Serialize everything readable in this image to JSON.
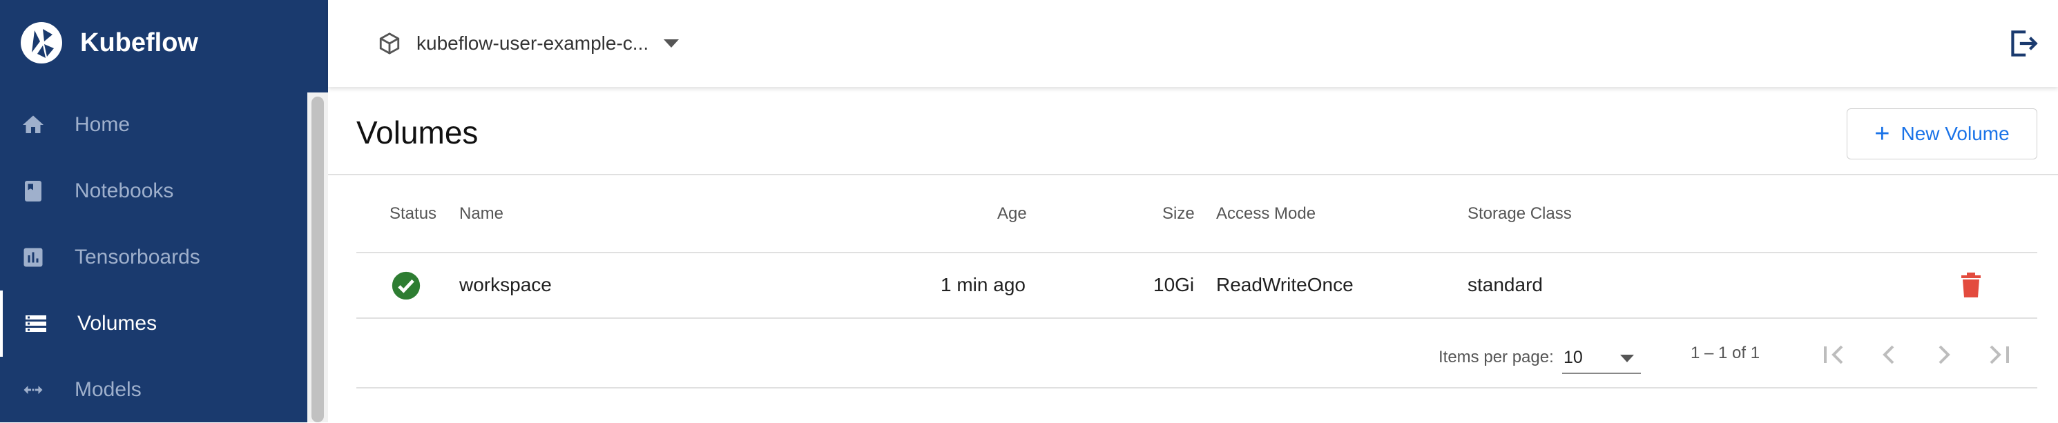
{
  "app": {
    "name": "Kubeflow"
  },
  "sidebar": {
    "items": [
      {
        "label": "Home",
        "icon": "home-icon"
      },
      {
        "label": "Notebooks",
        "icon": "notebook-icon"
      },
      {
        "label": "Tensorboards",
        "icon": "chart-icon"
      },
      {
        "label": "Volumes",
        "icon": "storage-icon",
        "active": true
      },
      {
        "label": "Models",
        "icon": "arrows-icon"
      }
    ]
  },
  "topbar": {
    "namespace": "kubeflow-user-example-c..."
  },
  "main": {
    "title": "Volumes",
    "new_button": "New Volume",
    "columns": [
      "Status",
      "Name",
      "Age",
      "Size",
      "Access Mode",
      "Storage Class"
    ],
    "rows": [
      {
        "status": "ready",
        "name": "workspace",
        "age": "1 min ago",
        "size": "10Gi",
        "access_mode": "ReadWriteOnce",
        "storage_class": "standard"
      }
    ],
    "paginator": {
      "label": "Items per page:",
      "page_size": "10",
      "range": "1 – 1 of 1"
    }
  },
  "colors": {
    "sidebar": "#1a3a6e",
    "accent": "#1a73e8",
    "success": "#2e7d32",
    "danger": "#e34b3e"
  }
}
